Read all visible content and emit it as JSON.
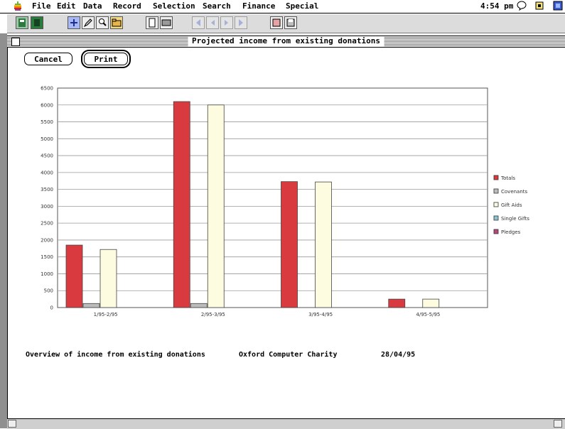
{
  "menubar": {
    "items": [
      "File",
      "Edit",
      "Data",
      "Record",
      "Selection",
      "Search",
      "Finance",
      "Special"
    ],
    "clock": "4:54 pm"
  },
  "window": {
    "title": "Projected income from existing donations"
  },
  "buttons": {
    "cancel": "Cancel",
    "print": "Print"
  },
  "chart_data": {
    "type": "bar",
    "categories": [
      "1/95-2/95",
      "2/95-3/95",
      "3/95-4/95",
      "4/95-5/95"
    ],
    "series": [
      {
        "name": "Totals",
        "color": "#d93a3f",
        "values": [
          1850,
          6100,
          3730,
          250
        ]
      },
      {
        "name": "Covenants",
        "color": "#bcbcbc",
        "values": [
          120,
          120,
          0,
          0
        ]
      },
      {
        "name": "Gift Aids",
        "color": "#fdfbe0",
        "values": [
          1720,
          6000,
          3720,
          250
        ]
      },
      {
        "name": "Single Gifts",
        "color": "#89c4cf",
        "values": [
          0,
          0,
          0,
          0
        ]
      },
      {
        "name": "Pledges",
        "color": "#b9457c",
        "values": [
          0,
          0,
          0,
          0
        ]
      }
    ],
    "yticks": [
      "0",
      "500",
      "1000",
      "1500",
      "2000",
      "2500",
      "3000",
      "3500",
      "4000",
      "4500",
      "5000",
      "5500",
      "6000",
      "6500"
    ],
    "ylim": [
      0,
      6500
    ],
    "grid": true,
    "legend": "right"
  },
  "footer": {
    "caption": "Overview of income from existing donations",
    "organization": "Oxford Computer Charity",
    "date": "28/04/95"
  }
}
